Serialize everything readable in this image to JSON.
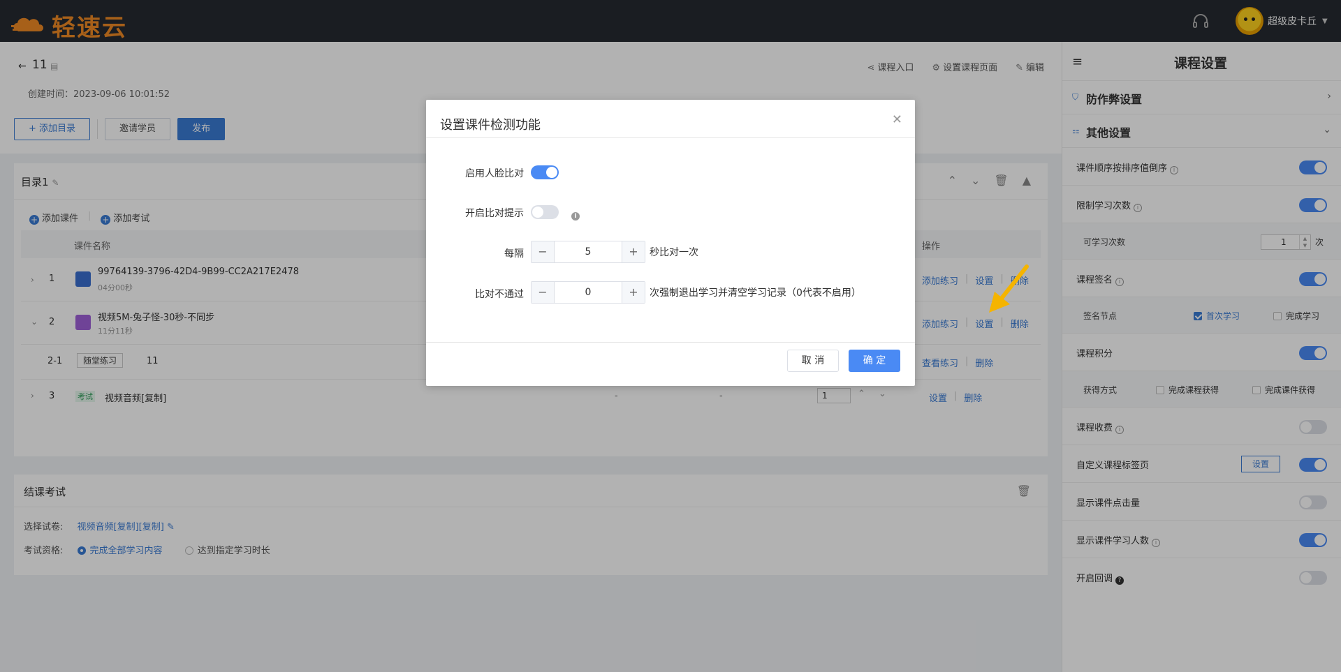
{
  "app": {
    "logo_text": "轻速云",
    "user_name": "超级皮卡丘"
  },
  "course": {
    "title": "11",
    "created": "创建时间：2023-09-06 10:01:52",
    "actions": [
      "课程入口",
      "设置课程页面",
      "编辑"
    ],
    "toolbar": {
      "add_dir": "添加目录",
      "invite": "邀请学员",
      "publish": "发布"
    }
  },
  "directory": {
    "title": "目录1",
    "add_course": "添加课件",
    "add_exam": "添加考试",
    "col_name": "课件名称",
    "col_op": "操作",
    "rows": [
      {
        "num": "1",
        "name": "99764139-3796-42D4-9B99-CC2A217E2478",
        "duration": "04分00秒",
        "ops": [
          "添加练习",
          "设置",
          "删除"
        ]
      },
      {
        "num": "2",
        "name": "视频5M-兔子怪-30秒-不同步",
        "duration": "11分11秒",
        "ops": [
          "添加练习",
          "设置",
          "删除"
        ]
      },
      {
        "num": "2-1",
        "tag": "随堂练习",
        "name": "11",
        "ops": [
          "查看练习",
          "删除"
        ]
      },
      {
        "num": "3",
        "tag": "考试",
        "name": "视频音频[复制]",
        "col_a": "-",
        "col_b": "-",
        "order": "1",
        "ops": [
          "设置",
          "删除"
        ]
      }
    ]
  },
  "final_exam": {
    "title": "结课考试",
    "paper_label": "选择试卷:",
    "paper_value": "视频音频[复制][复制]",
    "qual_label": "考试资格:",
    "qual_opt1": "完成全部学习内容",
    "qual_opt2": "达到指定学习时长"
  },
  "right_panel": {
    "title": "课程设置",
    "anti_cheat": "防作弊设置",
    "other": "其他设置",
    "items": {
      "order": "课件顺序按排序值倒序",
      "limit": "限制学习次数",
      "limit_count_label": "可学习次数",
      "limit_count": "1",
      "limit_unit": "次",
      "sign": "课程签名",
      "sign_node": "签名节点",
      "sign_first": "首次学习",
      "sign_done": "完成学习",
      "points": "课程积分",
      "points_way": "获得方式",
      "points_course": "完成课程获得",
      "points_item": "完成课件获得",
      "fee": "课程收费",
      "custom_tab": "自定义课程标签页",
      "custom_tab_btn": "设置",
      "show_clicks": "显示课件点击量",
      "show_learners": "显示课件学习人数",
      "callback": "开启回调"
    }
  },
  "dialog": {
    "title": "设置课件检测功能",
    "face_label": "启用人脸比对",
    "tip_label": "开启比对提示",
    "interval_label": "每隔",
    "interval_value": "5",
    "interval_hint": "秒比对一次",
    "fail_label": "比对不通过",
    "fail_value": "0",
    "fail_hint": "次强制退出学习并清空学习记录（0代表不启用）",
    "cancel": "取 消",
    "ok": "确 定"
  },
  "colors": {
    "accent": "#4a8af4",
    "brand_orange": "#f08a24",
    "topbar": "#262a31"
  }
}
